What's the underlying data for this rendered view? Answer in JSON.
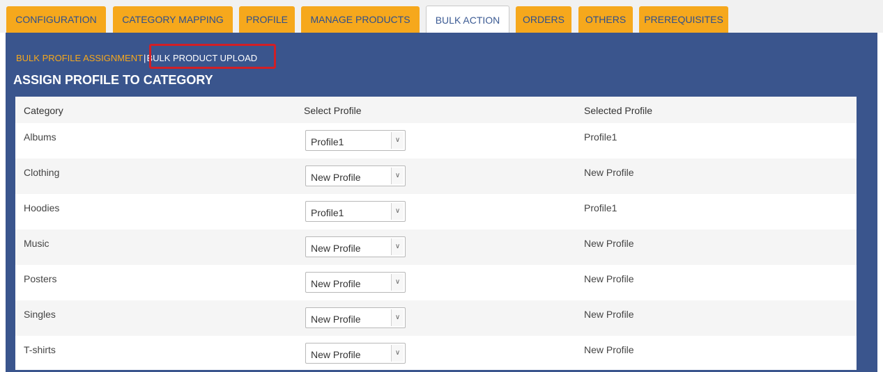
{
  "tabs": [
    {
      "label": "CONFIGURATION",
      "active": false
    },
    {
      "label": "CATEGORY MAPPING",
      "active": false
    },
    {
      "label": "PROFILE",
      "active": false
    },
    {
      "label": "MANAGE PRODUCTS",
      "active": false
    },
    {
      "label": "BULK ACTION",
      "active": true
    },
    {
      "label": "ORDERS",
      "active": false
    },
    {
      "label": "OTHERS",
      "active": false
    },
    {
      "label": "PREREQUISITES",
      "active": false
    }
  ],
  "sublinks": {
    "assignment": "BULK PROFILE ASSIGNMENT",
    "separator": "|",
    "upload": "BULK PRODUCT UPLOAD"
  },
  "page_title": "ASSIGN PROFILE TO CATEGORY",
  "table": {
    "headers": [
      "Category",
      "Select Profile",
      "Selected Profile"
    ],
    "rows": [
      {
        "category": "Albums",
        "select": "Profile1",
        "selected": "Profile1"
      },
      {
        "category": "Clothing",
        "select": "New Profile",
        "selected": "New Profile"
      },
      {
        "category": "Hoodies",
        "select": "Profile1",
        "selected": "Profile1"
      },
      {
        "category": "Music",
        "select": "New Profile",
        "selected": "New Profile"
      },
      {
        "category": "Posters",
        "select": "New Profile",
        "selected": "New Profile"
      },
      {
        "category": "Singles",
        "select": "New Profile",
        "selected": "New Profile"
      },
      {
        "category": "T-shirts",
        "select": "New Profile",
        "selected": "New Profile"
      }
    ]
  },
  "colors": {
    "tab_orange": "#f6a81c",
    "panel_blue": "#3a558d",
    "highlight_red": "#d11f26"
  },
  "icons": {
    "dropdown": "chevron-down-icon"
  }
}
